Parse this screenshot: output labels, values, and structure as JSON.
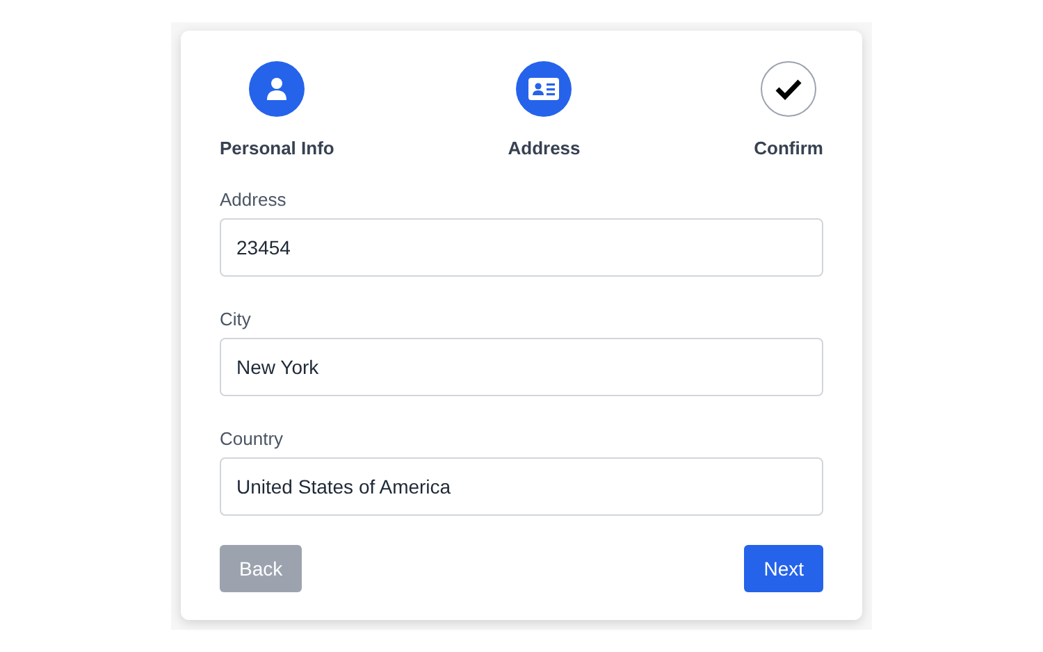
{
  "steps": [
    {
      "label": "Personal Info",
      "kind": "person",
      "active": true
    },
    {
      "label": "Address",
      "kind": "card",
      "active": true
    },
    {
      "label": "Confirm",
      "kind": "check",
      "active": false
    }
  ],
  "fields": [
    {
      "label": "Address",
      "value": "23454"
    },
    {
      "label": "City",
      "value": "New York"
    },
    {
      "label": "Country",
      "value": "United States of America"
    }
  ],
  "buttons": [
    {
      "label": "Back",
      "disabled": true
    },
    {
      "label": "Next",
      "disabled": false
    }
  ]
}
